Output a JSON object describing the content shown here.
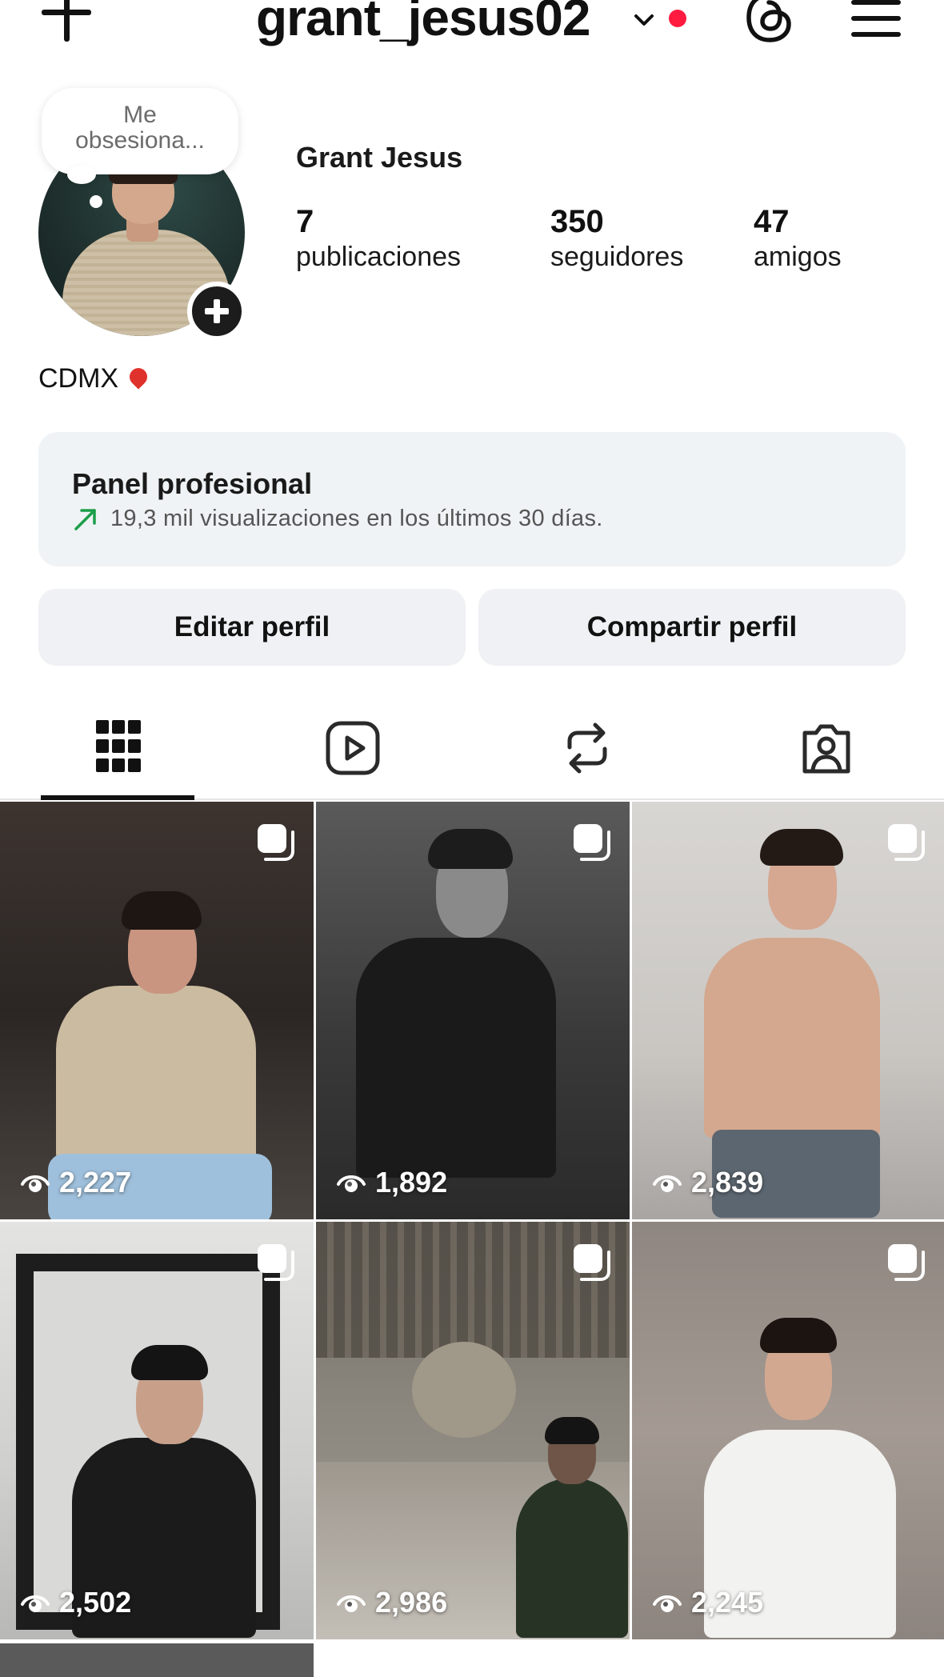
{
  "header": {
    "username": "grant_jesus02",
    "icons": [
      "plus-icon",
      "chevron-down-icon",
      "notification-dot",
      "threads-icon",
      "menu-icon"
    ],
    "dot_color": "#ff1a40"
  },
  "profile": {
    "note": "Me obsesiona...",
    "display_name": "Grant Jesus",
    "stats": [
      {
        "value": "7",
        "label": "publicaciones"
      },
      {
        "value": "350",
        "label": "seguidores"
      },
      {
        "value": "47",
        "label": "amigos"
      }
    ],
    "bio": "CDMX"
  },
  "pro_panel": {
    "title": "Panel profesional",
    "subtitle": "19,3 mil visualizaciones en los últimos 30 días.",
    "trend_color": "#1a9e4a"
  },
  "actions": {
    "edit_label": "Editar perfil",
    "share_label": "Compartir perfil"
  },
  "tabs": [
    {
      "name": "posts-grid",
      "icon": "grid-icon",
      "active": true
    },
    {
      "name": "reels",
      "icon": "reels-icon",
      "active": false
    },
    {
      "name": "reposts",
      "icon": "repost-icon",
      "active": false
    },
    {
      "name": "tagged",
      "icon": "tagged-icon",
      "active": false
    }
  ],
  "posts": [
    {
      "views": "2,227"
    },
    {
      "views": "1,892"
    },
    {
      "views": "2,839"
    },
    {
      "views": "2,502"
    },
    {
      "views": "2,986"
    },
    {
      "views": "2,245"
    }
  ]
}
